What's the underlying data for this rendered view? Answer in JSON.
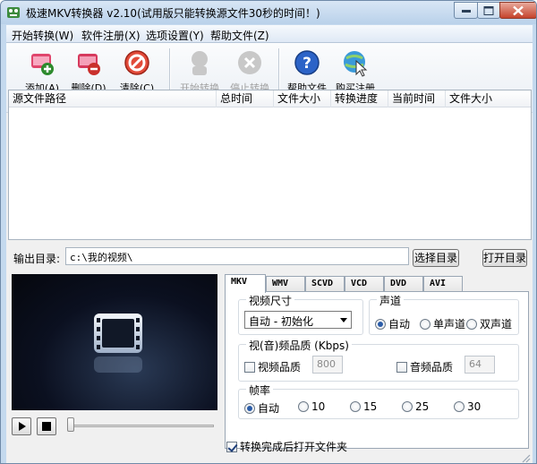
{
  "window": {
    "title": "极速MKV转换器 v2.10(试用版只能转换源文件30秒的时间！)"
  },
  "menu": [
    "开始转换(W)",
    "软件注册(X)",
    "选项设置(Y)",
    "帮助文件(Z)"
  ],
  "toolbar": {
    "add": "添加(A)",
    "delete": "删除(D)",
    "clear": "清除(C)",
    "start": "开始转换",
    "stop": "停止转换",
    "help": "帮助文件",
    "buy": "购买注册"
  },
  "list": {
    "columns": [
      "源文件路径",
      "总时间",
      "文件大小",
      "转换进度",
      "当前时间",
      "文件大小"
    ]
  },
  "output": {
    "label": "输出目录:",
    "value": "c:\\我的视频\\",
    "choose_button": "选择目录",
    "open_button": "打开目录"
  },
  "tabs": [
    "MKV",
    "WMV",
    "SCVD",
    "VCD",
    "DVD",
    "AVI"
  ],
  "settings": {
    "video_size": {
      "title": "视频尺寸",
      "selected": "自动 - 初始化"
    },
    "audio_channel": {
      "title": "声道",
      "options": [
        "自动",
        "单声道",
        "双声道"
      ],
      "selected": "自动"
    },
    "quality": {
      "title": "视(音)频品质 (Kbps)",
      "video_label": "视频品质",
      "video_value": "800",
      "audio_label": "音频品质",
      "audio_value": "64"
    },
    "frame_rate": {
      "title": "帧率",
      "options": [
        "自动",
        "10",
        "15",
        "25",
        "30"
      ],
      "selected": "自动"
    }
  },
  "open_after": {
    "label": "转换完成后打开文件夹",
    "checked": true
  }
}
